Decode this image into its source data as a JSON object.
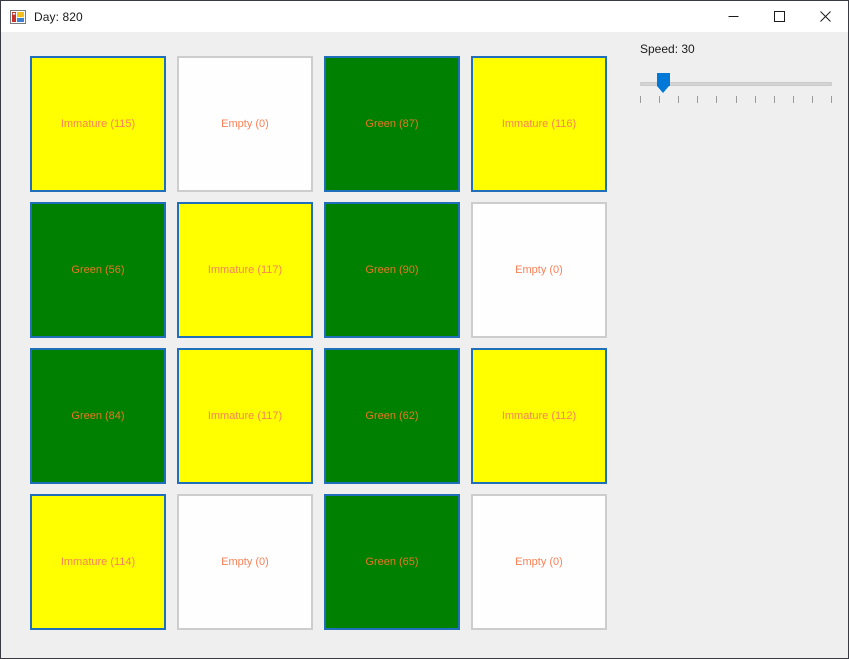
{
  "window": {
    "title": "Day: 820",
    "icon": "winforms-app-icon",
    "controls": [
      {
        "name": "minimize-button",
        "glyph": "minimize-icon",
        "label": "Minimize"
      },
      {
        "name": "maximize-button",
        "glyph": "maximize-icon",
        "label": "Maximize"
      },
      {
        "name": "close-button",
        "glyph": "close-icon",
        "label": "Close"
      }
    ]
  },
  "colors": {
    "client_background": "#efefef",
    "title_background": "#ffffff",
    "window_border": "#3a3a45",
    "cell_border_active": "#1f6fba",
    "cell_border_empty": "#cdcdcd",
    "immature_fill": "#ffff00",
    "green_fill": "#008000",
    "empty_fill": "#fefefe",
    "text_on_yellow": "#fa8258",
    "text_on_green": "#e8761f",
    "text_on_empty": "#fa8258",
    "slider_accent": "#0078d7",
    "slider_track": "#d4d4d4",
    "slider_tick": "#9a9a9a"
  },
  "grid": {
    "rows": 4,
    "columns": 4,
    "cells": [
      {
        "state": "immature",
        "label": "Immature (115)",
        "type": "Immature",
        "count": 115
      },
      {
        "state": "empty",
        "label": "Empty (0)",
        "type": "Empty",
        "count": 0
      },
      {
        "state": "green",
        "label": "Green (87)",
        "type": "Green",
        "count": 87
      },
      {
        "state": "immature",
        "label": "Immature (116)",
        "type": "Immature",
        "count": 116
      },
      {
        "state": "green",
        "label": "Green (56)",
        "type": "Green",
        "count": 56
      },
      {
        "state": "immature",
        "label": "Immature (117)",
        "type": "Immature",
        "count": 117
      },
      {
        "state": "green",
        "label": "Green (90)",
        "type": "Green",
        "count": 90
      },
      {
        "state": "empty",
        "label": "Empty (0)",
        "type": "Empty",
        "count": 0
      },
      {
        "state": "green",
        "label": "Green (84)",
        "type": "Green",
        "count": 84
      },
      {
        "state": "immature",
        "label": "Immature (117)",
        "type": "Immature",
        "count": 117
      },
      {
        "state": "green",
        "label": "Green (62)",
        "type": "Green",
        "count": 62
      },
      {
        "state": "immature",
        "label": "Immature (112)",
        "type": "Immature",
        "count": 112
      },
      {
        "state": "immature",
        "label": "Immature (114)",
        "type": "Immature",
        "count": 114
      },
      {
        "state": "empty",
        "label": "Empty (0)",
        "type": "Empty",
        "count": 0
      },
      {
        "state": "green",
        "label": "Green (65)",
        "type": "Green",
        "count": 65
      },
      {
        "state": "empty",
        "label": "Empty (0)",
        "type": "Empty",
        "count": 0
      }
    ]
  },
  "speed": {
    "label": "Speed: 30",
    "value": 30,
    "min": 0,
    "max": 100,
    "thumb_position_percent": 21,
    "tick_count": 11
  }
}
